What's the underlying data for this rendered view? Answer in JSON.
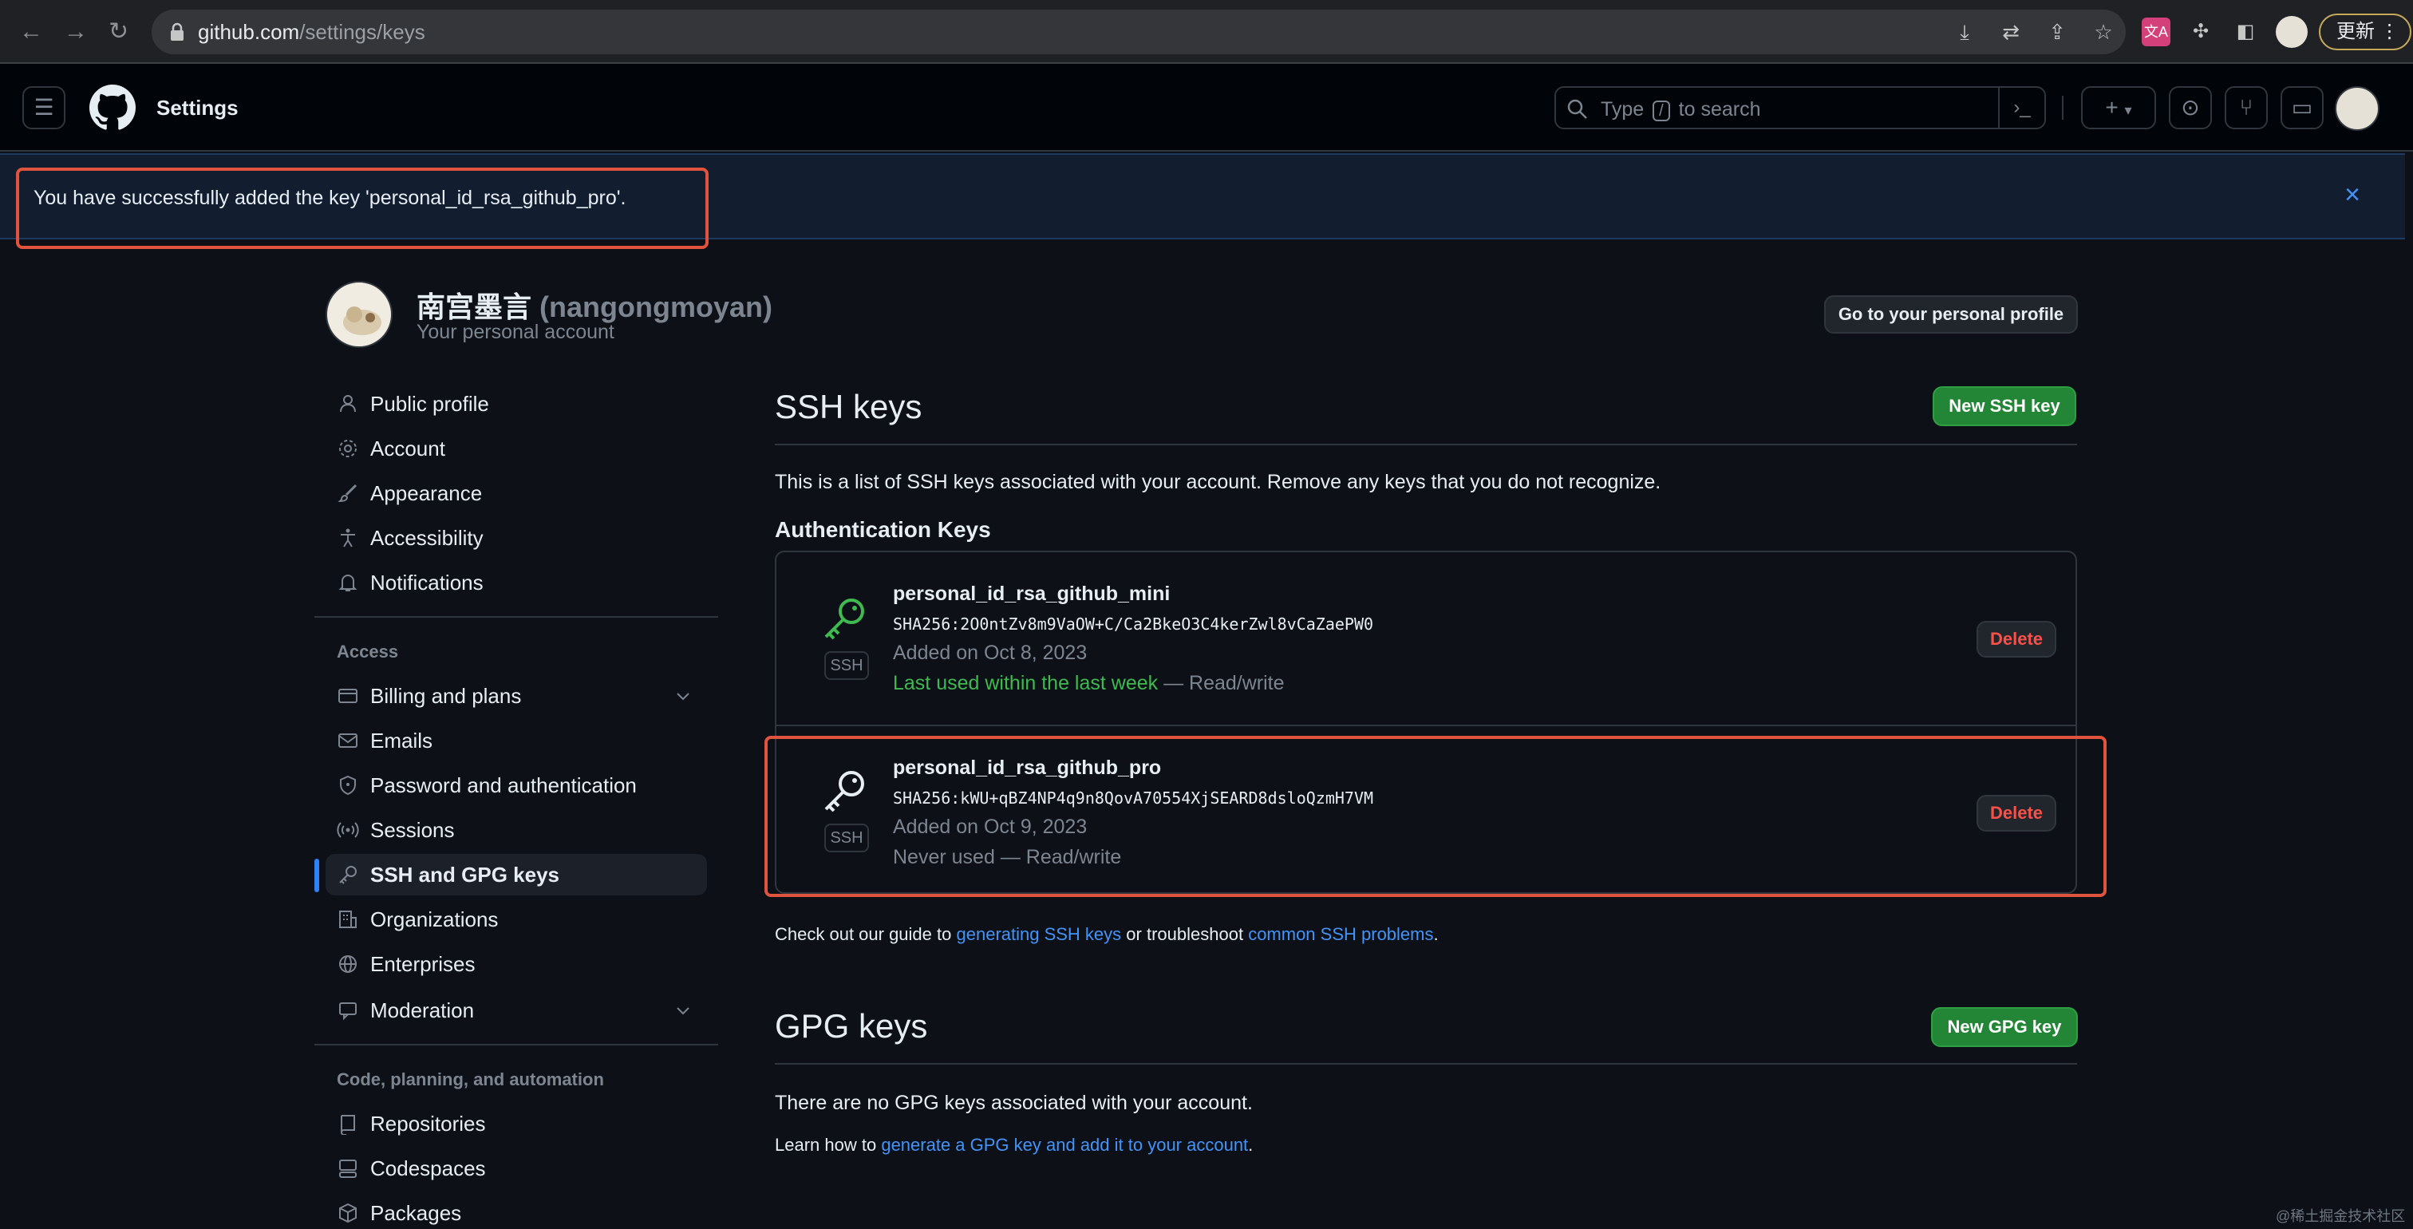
{
  "browser": {
    "url_host": "github.com",
    "url_path": "/settings/keys",
    "update_label": "更新"
  },
  "header": {
    "title": "Settings",
    "search_prefix": "Type",
    "search_key": "/",
    "search_suffix": "to search",
    "command_glyph": "›_",
    "create_glyph": "+"
  },
  "flash": {
    "message": "You have successfully added the key 'personal_id_rsa_github_pro'.",
    "close_glyph": "×"
  },
  "profile": {
    "display_name": "南宫墨言",
    "login": "(nangongmoyan)",
    "subtitle": "Your personal account",
    "go_profile_label": "Go to your personal profile"
  },
  "sidebar": {
    "items_top": [
      {
        "label": "Public profile",
        "icon": "person-icon"
      },
      {
        "label": "Account",
        "icon": "gear-icon"
      },
      {
        "label": "Appearance",
        "icon": "paintbrush-icon"
      },
      {
        "label": "Accessibility",
        "icon": "accessibility-icon"
      },
      {
        "label": "Notifications",
        "icon": "bell-icon"
      }
    ],
    "access_heading": "Access",
    "items_access": [
      {
        "label": "Billing and plans",
        "icon": "credit-card-icon"
      },
      {
        "label": "Emails",
        "icon": "mail-icon"
      },
      {
        "label": "Password and authentication",
        "icon": "shield-lock-icon"
      },
      {
        "label": "Sessions",
        "icon": "broadcast-icon"
      },
      {
        "label": "SSH and GPG keys",
        "icon": "key-icon"
      },
      {
        "label": "Organizations",
        "icon": "organization-icon"
      },
      {
        "label": "Enterprises",
        "icon": "globe-icon"
      },
      {
        "label": "Moderation",
        "icon": "moderation-icon"
      }
    ],
    "code_heading": "Code, planning, and automation",
    "items_code": [
      {
        "label": "Repositories",
        "icon": "repo-icon"
      },
      {
        "label": "Codespaces",
        "icon": "codespaces-icon"
      },
      {
        "label": "Packages",
        "icon": "package-icon"
      }
    ]
  },
  "ssh": {
    "title": "SSH keys",
    "new_label": "New SSH key",
    "description": "This is a list of SSH keys associated with your account. Remove any keys that you do not recognize.",
    "auth_heading": "Authentication Keys",
    "badge": "SSH",
    "delete_label": "Delete",
    "keys": [
      {
        "name": "personal_id_rsa_github_mini",
        "fingerprint": "SHA256:2O0ntZv8m9VaOW+C/Ca2BkeO3C4kerZwl8vCaZaePW0",
        "added": "Added on Oct 8, 2023",
        "last_used": "Last used within the last week",
        "access": "— Read/write"
      },
      {
        "name": "personal_id_rsa_github_pro",
        "fingerprint": "SHA256:kWU+qBZ4NP4q9n8QovA70554XjSEARD8dsloQzmH7VM",
        "added": "Added on Oct 9, 2023",
        "last_used": "Never used",
        "access": "— Read/write"
      }
    ],
    "guide_prefix": "Check out our guide to",
    "guide_link1": "generating SSH keys",
    "guide_middle": "or troubleshoot",
    "guide_link2": "common SSH problems",
    "guide_suffix": "."
  },
  "gpg": {
    "title": "GPG keys",
    "new_label": "New GPG key",
    "empty_text": "There are no GPG keys associated with your account.",
    "learn_prefix": "Learn how to",
    "learn_link": "generate a GPG key and add it to your account",
    "learn_suffix": "."
  },
  "watermark": "@稀土掘金技术社区"
}
